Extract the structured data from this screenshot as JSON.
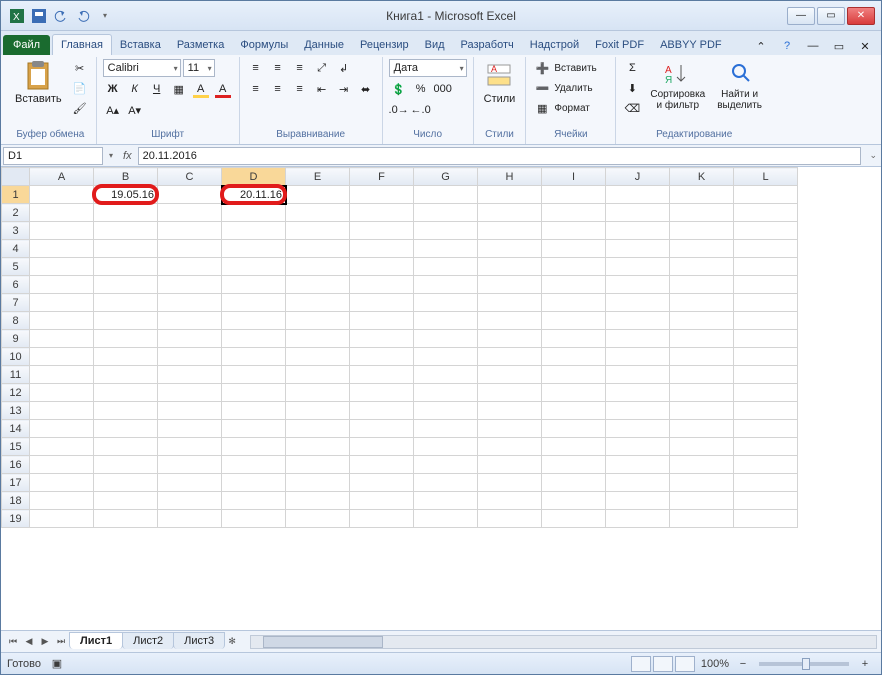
{
  "title": "Книга1  -  Microsoft Excel",
  "qat": [
    "excel",
    "save",
    "undo",
    "redo"
  ],
  "tabs": [
    "Файл",
    "Главная",
    "Вставка",
    "Разметка",
    "Формулы",
    "Данные",
    "Рецензир",
    "Вид",
    "Разработч",
    "Надстрой",
    "Foxit PDF",
    "ABBYY PDF"
  ],
  "activeTab": 1,
  "ribbon": {
    "clipboard": {
      "paste": "Вставить",
      "label": "Буфер обмена"
    },
    "font": {
      "name": "Calibri",
      "size": "11",
      "label": "Шрифт",
      "bold": "Ж",
      "italic": "К",
      "underline": "Ч"
    },
    "align": {
      "label": "Выравнивание"
    },
    "number": {
      "format": "Дата",
      "label": "Число"
    },
    "styles": {
      "label": "Стили",
      "btn": "Стили"
    },
    "cells": {
      "insert": "Вставить",
      "delete": "Удалить",
      "format": "Формат",
      "label": "Ячейки"
    },
    "editing": {
      "sort": "Сортировка\nи фильтр",
      "find": "Найти и\nвыделить",
      "label": "Редактирование"
    }
  },
  "namebox": "D1",
  "formula": "20.11.2016",
  "columns": [
    "A",
    "B",
    "C",
    "D",
    "E",
    "F",
    "G",
    "H",
    "I",
    "J",
    "K",
    "L"
  ],
  "selectedCol": "D",
  "selectedRow": 1,
  "rows": 19,
  "cells": {
    "B1": "19.05.16",
    "D1": "20.11.16"
  },
  "highlightCells": [
    "B1",
    "D1"
  ],
  "sheets": [
    "Лист1",
    "Лист2",
    "Лист3"
  ],
  "activeSheet": 0,
  "status": "Готово",
  "zoom": "100%"
}
